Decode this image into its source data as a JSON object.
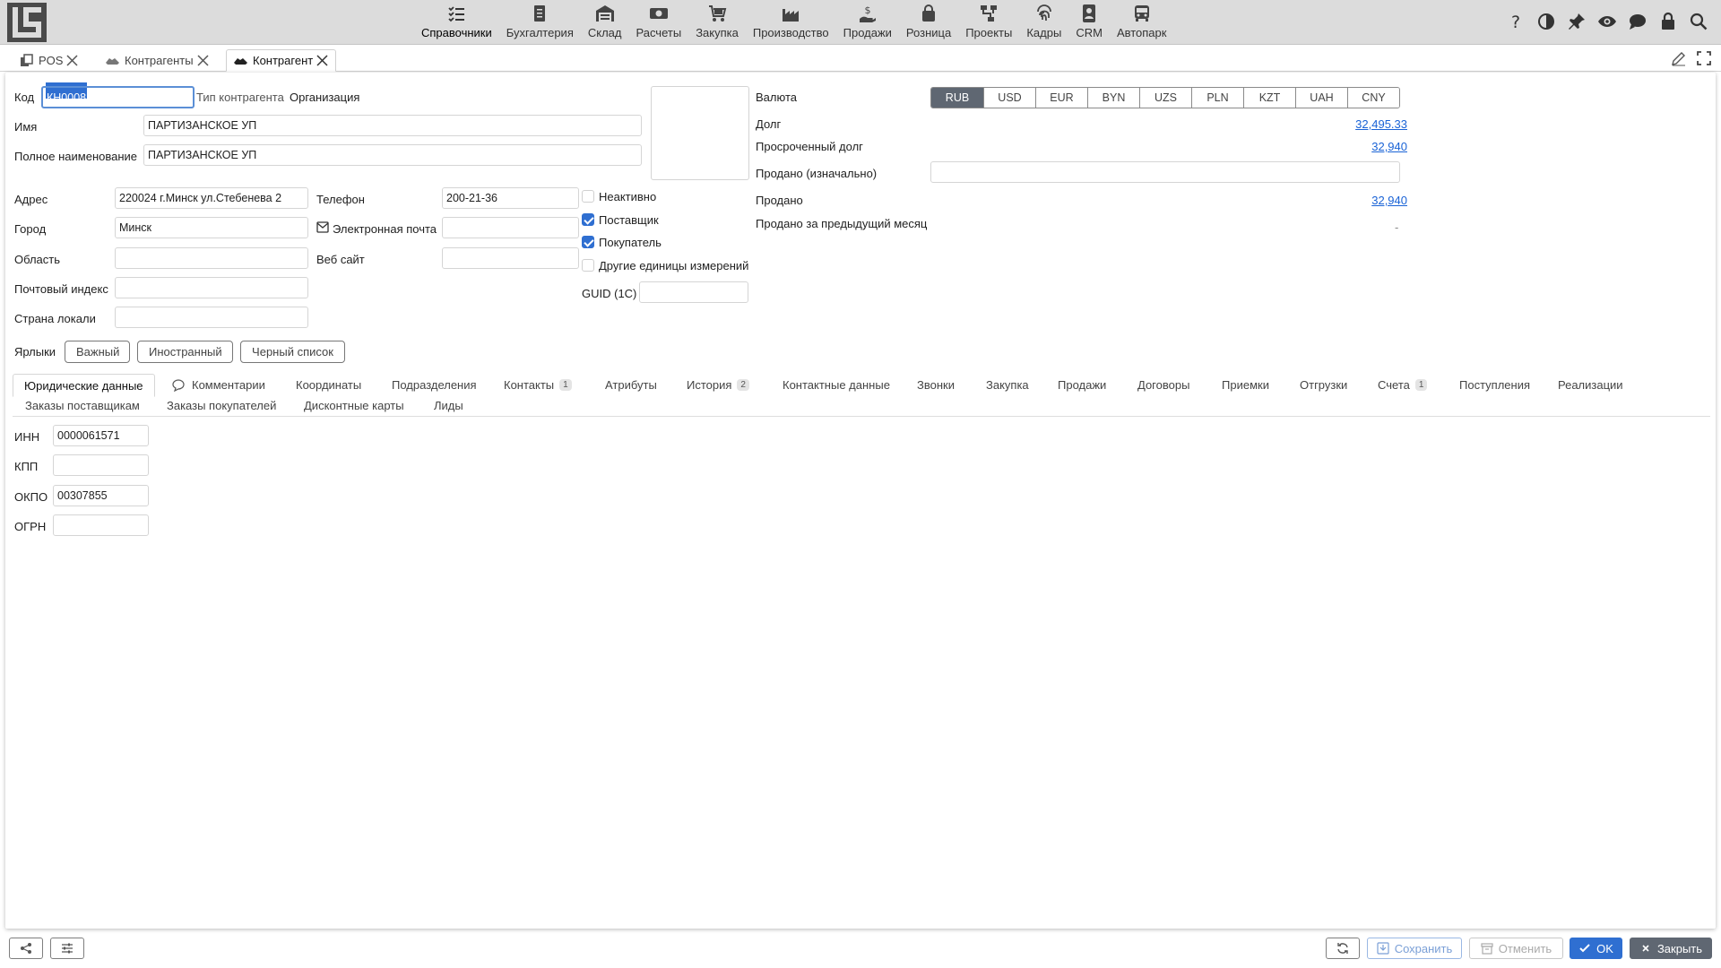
{
  "modules": [
    {
      "label": "Справочники",
      "icon": "checklist-icon"
    },
    {
      "label": "Бухгалтерия",
      "icon": "ledger-icon"
    },
    {
      "label": "Склад",
      "icon": "warehouse-icon"
    },
    {
      "label": "Расчеты",
      "icon": "money-icon"
    },
    {
      "label": "Закупка",
      "icon": "cart-icon"
    },
    {
      "label": "Производство",
      "icon": "factory-icon"
    },
    {
      "label": "Продажи",
      "icon": "hand-money-icon"
    },
    {
      "label": "Розница",
      "icon": "bag-icon"
    },
    {
      "label": "Проекты",
      "icon": "project-icon"
    },
    {
      "label": "Кадры",
      "icon": "fingerprint-icon"
    },
    {
      "label": "CRM",
      "icon": "contact-card-icon"
    },
    {
      "label": "Автопарк",
      "icon": "bus-icon"
    }
  ],
  "tabs": [
    {
      "label": "POS"
    },
    {
      "label": "Контрагенты"
    },
    {
      "label": "Контрагент"
    }
  ],
  "form": {
    "code_label": "Код",
    "code_value": "КН0008",
    "type_label": "Тип контрагента",
    "type_value": "Организация",
    "name_label": "Имя",
    "name_value": "ПАРТИЗАНСКОЕ УП",
    "fullname_label": "Полное наименование",
    "fullname_value": "ПАРТИЗАНСКОЕ УП",
    "address_label": "Адрес",
    "address_value": "220024 г.Минск ул.Стебенева 2",
    "city_label": "Город",
    "city_value": "Минск",
    "region_label": "Область",
    "region_value": "",
    "postal_label": "Почтовый индекс",
    "postal_value": "",
    "country_label": "Страна локали",
    "country_value": "",
    "phone_label": "Телефон",
    "phone_value": "200-21-36",
    "email_label": "Электронная почта",
    "email_value": "",
    "website_label": "Веб сайт",
    "website_value": "",
    "inactive_label": "Неактивно",
    "supplier_label": "Поставщик",
    "buyer_label": "Покупатель",
    "units_label": "Другие единицы измерений",
    "guid_label": "GUID (1С)",
    "guid_value": ""
  },
  "finance": {
    "currency_label": "Валюта",
    "currencies": [
      "RUB",
      "USD",
      "EUR",
      "BYN",
      "UZS",
      "PLN",
      "KZT",
      "UAH",
      "CNY"
    ],
    "active_currency": "RUB",
    "debt_label": "Долг",
    "debt_value": "32,495.33",
    "overdue_label": "Просроченный долг",
    "overdue_value": "32,940",
    "sold_initial_label": "Продано (изначально)",
    "sold_initial_value": "",
    "sold_label": "Продано",
    "sold_value": "32,940",
    "sold_prev_label": "Продано за предыдущий месяц",
    "sold_prev_value": "-"
  },
  "tags": {
    "label": "Ярлыки",
    "items": [
      "Важный",
      "Иностранный",
      "Черный список"
    ]
  },
  "subtabs": [
    {
      "label": "Юридические данные"
    },
    {
      "label": "Комментарии"
    },
    {
      "label": "Координаты"
    },
    {
      "label": "Подразделения"
    },
    {
      "label": "Контакты",
      "badge": "1"
    },
    {
      "label": "Атрибуты"
    },
    {
      "label": "История",
      "badge": "2"
    },
    {
      "label": "Контактные данные"
    },
    {
      "label": "Звонки"
    },
    {
      "label": "Закупка"
    },
    {
      "label": "Продажи"
    },
    {
      "label": "Договоры"
    },
    {
      "label": "Приемки"
    },
    {
      "label": "Отгрузки"
    },
    {
      "label": "Счета",
      "badge": "1"
    },
    {
      "label": "Поступления"
    },
    {
      "label": "Реализации"
    },
    {
      "label": "Заказы поставщикам"
    },
    {
      "label": "Заказы покупателей"
    },
    {
      "label": "Дисконтные карты"
    },
    {
      "label": "Лиды"
    }
  ],
  "legal": {
    "inn_label": "ИНН",
    "inn_value": "0000061571",
    "kpp_label": "КПП",
    "kpp_value": "",
    "okpo_label": "ОКПО",
    "okpo_value": "00307855",
    "ogrn_label": "ОГРН",
    "ogrn_value": ""
  },
  "footer": {
    "save": "Сохранить",
    "cancel": "Отменить",
    "ok": "OK",
    "close": "Закрыть"
  },
  "colors": {
    "accent": "#2f6fd1",
    "link": "#1a63d6",
    "close_btn": "#5f6772",
    "topbar": "#dcdcdc"
  }
}
